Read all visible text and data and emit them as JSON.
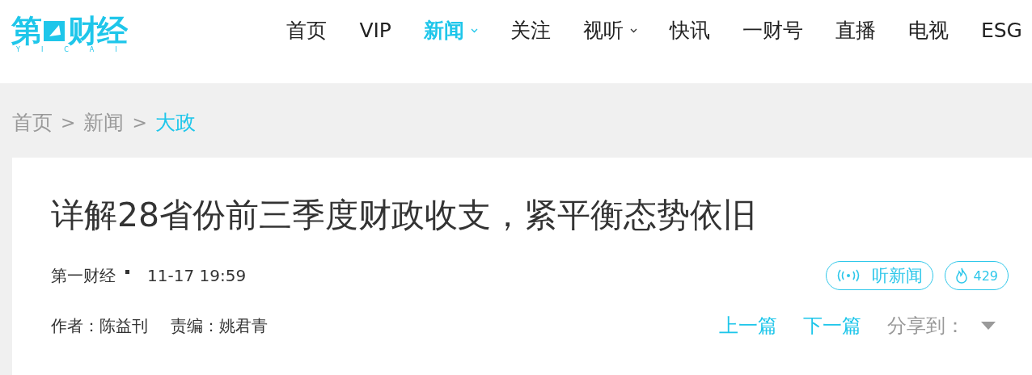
{
  "logo": {
    "text_before": "第",
    "text_after": "财经",
    "subtitle": "YICAI"
  },
  "nav": [
    {
      "label": "首页",
      "selected": false,
      "has_menu": false
    },
    {
      "label": "VIP",
      "selected": false,
      "has_menu": false
    },
    {
      "label": "新闻",
      "selected": true,
      "has_menu": true
    },
    {
      "label": "关注",
      "selected": false,
      "has_menu": false
    },
    {
      "label": "视听",
      "selected": false,
      "has_menu": true
    },
    {
      "label": "快讯",
      "selected": false,
      "has_menu": false
    },
    {
      "label": "一财号",
      "selected": false,
      "has_menu": false
    },
    {
      "label": "直播",
      "selected": false,
      "has_menu": false
    },
    {
      "label": "电视",
      "selected": false,
      "has_menu": false
    },
    {
      "label": "ESG",
      "selected": false,
      "has_menu": false
    }
  ],
  "breadcrumb": [
    {
      "label": "首页",
      "selected": false
    },
    {
      "label": "新闻",
      "selected": false
    },
    {
      "label": "大政",
      "selected": true
    }
  ],
  "breadcrumb_separator": ">",
  "article": {
    "title": "详解28省份前三季度财政收支，紧平衡态势依旧",
    "source": "第一财经",
    "time": "11-17 19:59",
    "listen_label": "听新闻",
    "heat": "429",
    "author": "作者：陈益刊",
    "editor": "责编：姚君青",
    "prev": "上一篇",
    "next": "下一篇",
    "share": "分享到："
  }
}
